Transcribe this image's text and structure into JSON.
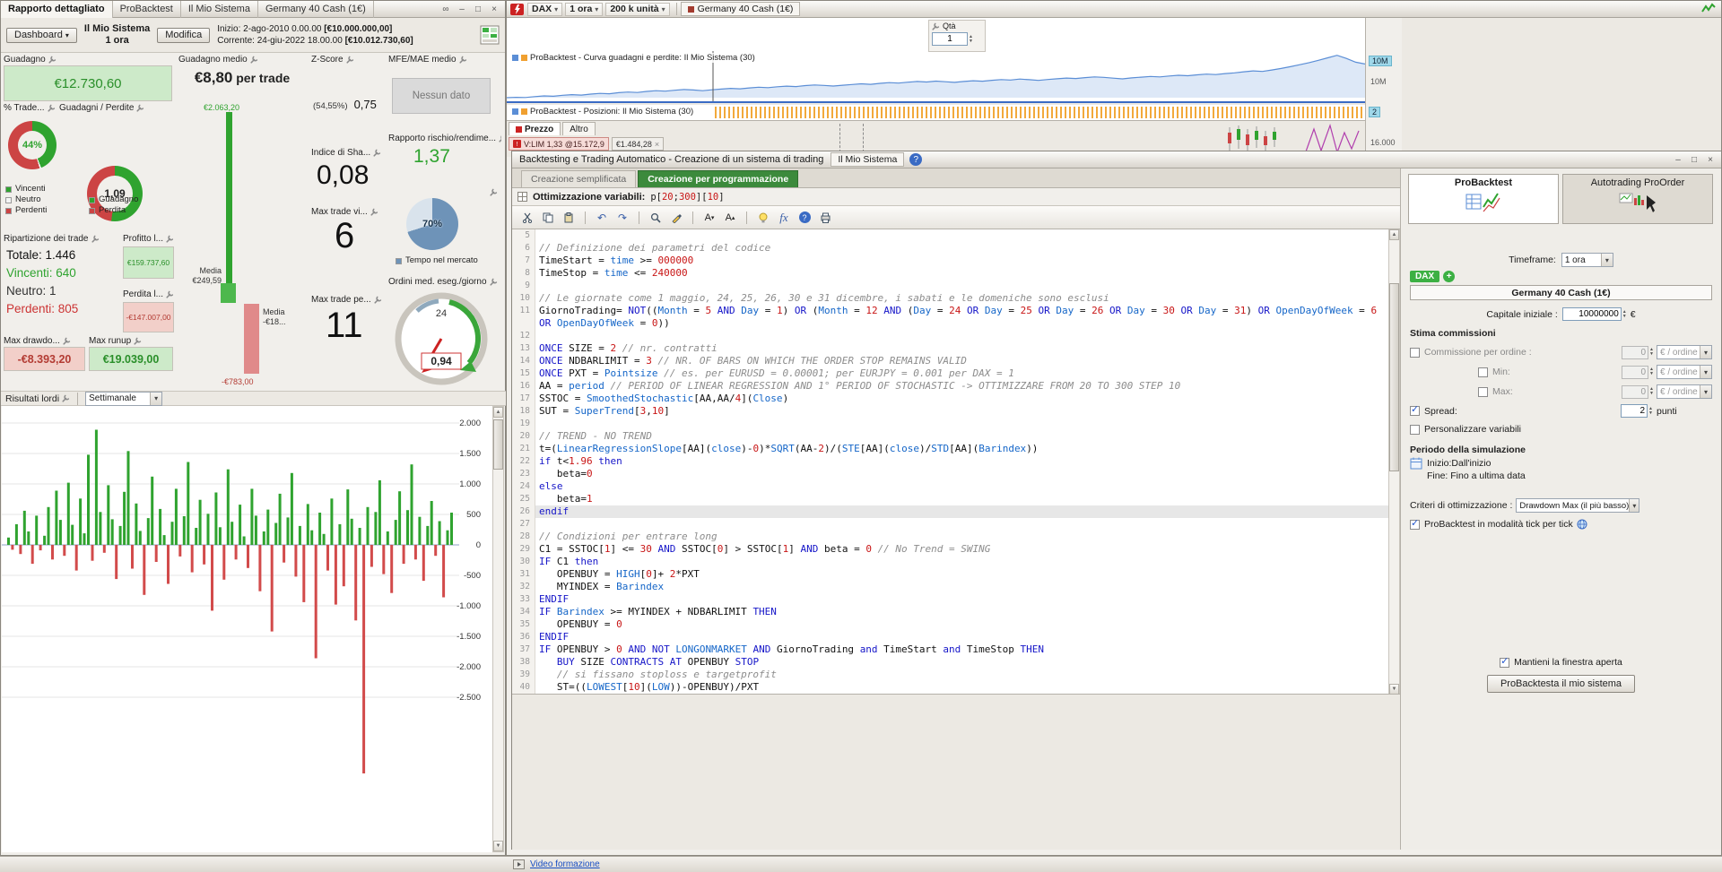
{
  "icons": {
    "link": "∞",
    "minimize": "–",
    "maximize": "□",
    "close": "×",
    "dropdown": "▾",
    "spin_up": "▲",
    "spin_down": "▼",
    "check": "✓",
    "undo": "↶",
    "redo": "↷",
    "font_letter": "A",
    "tri_up": "▴",
    "tri_down": "▾",
    "fx": "fx",
    "help": "?",
    "plus": "+",
    "chip_close": "×"
  },
  "colors": {
    "green": "#2fa32f",
    "green_bg": "#cdeac9",
    "red": "#cc4444",
    "red_bg": "#f2cfc9",
    "blue": "#3a6bc4",
    "orange": "#f0a030",
    "prog_tab_green": "#3c8a3c"
  },
  "left_window": {
    "tabs": [
      "Rapporto dettagliato",
      "ProBacktest",
      "Il Mio Sistema",
      "Germany 40 Cash (1€)"
    ],
    "header": {
      "dashboard_label": "Dashboard",
      "system_name": "Il Mio Sistema",
      "system_timeframe": "1 ora",
      "modify_label": "Modifica",
      "inizio_label": "Inizio:",
      "inizio_datetime": "2-ago-2010 0.00.00",
      "inizio_amount": "[€10.000.000,00]",
      "corrente_label": "Corrente:",
      "corrente_datetime": "24-giu-2022 18.00.00",
      "corrente_amount": "[€10.012.730,60]"
    },
    "stats": {
      "guadagno_label": "Guadagno",
      "guadagno_value": "€12.730,60",
      "gm_label": "Guadagno medio",
      "gm_value": "€8,80",
      "gm_suffix": " per trade",
      "z_label": "Z-Score",
      "z_pct": "(54,55%)",
      "z_value": "0,75",
      "mfe_label": "MFE/MAE medio",
      "mfe_value": "Nessun dato",
      "pct_trade_label": "% Trade...",
      "gp_label": "Guadagni / Perdite",
      "sharpe_label": "Indice di Sha...",
      "sharpe_value": "0,08",
      "rr_label": "Rapporto rischio/rendime...",
      "rr_value": "1,37",
      "mtv_label": "Max trade vi...",
      "mtv_value": "6",
      "mtp_label": "Max trade pe...",
      "mtp_value": "11",
      "ordini_label": "Ordini med. eseg./giorno",
      "rip_label": "Ripartizione dei trade",
      "rip_totale": "Totale: 1.446",
      "rip_vincenti": "Vincenti: 640",
      "rip_neutro": "Neutro: 1",
      "rip_perdenti": "Perdenti: 805",
      "profitto_label": "Profitto l...",
      "profitto_value": "€159.737,60",
      "perdita_label": "Perdita l...",
      "perdita_value": "-€147.007,00",
      "bar_max_label": "€2.063,20",
      "bar_media_pos_1": "Media",
      "bar_media_pos_2": "€249,59",
      "bar_media_neg_1": "Media",
      "bar_media_neg_2": "-€18...",
      "bar_min_label": "-€783,00",
      "mdd_label": "Max drawdo...",
      "mdd_value": "-€8.393,20",
      "mru_label": "Max runup",
      "mru_value": "€19.039,00"
    },
    "bottom_chart": {
      "title": "Risultati lordi",
      "period": "Settimanale"
    }
  },
  "chart_window": {
    "symbol": "DAX",
    "timeframe": "1 ora",
    "units": "200 k unità",
    "instrument_tab": "Germany 40 Cash (1€)",
    "qta_label": "Qtà",
    "qta_value": "1",
    "equity_title": "ProBacktest - Curva guadagni e perdite: Il Mio Sistema (30)",
    "positions_title": "ProBacktest - Posizioni: Il Mio Sistema (30)",
    "axis_equity_badge": "10M",
    "axis_equity_label": "10M",
    "axis_positions_badge": "2",
    "axis_price_label": "16.000",
    "tab_prezzo": "Prezzo",
    "tab_altro": "Altro",
    "chip_vlim": "V:LIM 1,33 @15.172,9",
    "chip_value": "€1.484,28"
  },
  "backtest_window": {
    "title": "Backtesting e Trading Automatico - Creazione di un sistema di trading",
    "title_tab": "Il Mio Sistema",
    "tab_simple": "Creazione semplificata",
    "tab_prog": "Creazione per programmazione",
    "optim_label": "Ottimizzazione variabili:",
    "optim_value": "p[20;300][10]",
    "current_line": 26,
    "code": [
      {
        "n": 5,
        "t": ""
      },
      {
        "n": 6,
        "t": "// Definizione dei parametri del codice"
      },
      {
        "n": 7,
        "t": "TimeStart = time >= 000000"
      },
      {
        "n": 8,
        "t": "TimeStop = time <= 240000"
      },
      {
        "n": 9,
        "t": ""
      },
      {
        "n": 10,
        "t": "// Le giornate come 1 maggio, 24, 25, 26, 30 e 31 dicembre, i sabati e le domeniche sono esclusi"
      },
      {
        "n": 11,
        "t": "GiornoTrading= NOT((Month = 5 AND Day = 1) OR (Month = 12 AND (Day = 24 OR Day = 25 OR Day = 26 OR Day = 30 OR Day = 31) OR OpenDayOfWeek = 6 OR OpenDayOfWeek = 0))"
      },
      {
        "n": 12,
        "t": ""
      },
      {
        "n": 13,
        "t": "ONCE SIZE = 2 // nr. contratti"
      },
      {
        "n": 14,
        "t": "ONCE NDBARLIMIT = 3 // NR. OF BARS ON WHICH THE ORDER STOP REMAINS VALID"
      },
      {
        "n": 15,
        "t": "ONCE PXT = Pointsize // es. per EURUSD = 0.00001; per EURJPY = 0.001 per DAX = 1"
      },
      {
        "n": 16,
        "t": "AA = period // PERIOD OF LINEAR REGRESSION AND 1° PERIOD OF STOCHASTIC -> OTTIMIZZARE FROM 20 TO 300 STEP 10"
      },
      {
        "n": 17,
        "t": "SSTOC = SmoothedStochastic[AA,AA/4](Close)"
      },
      {
        "n": 18,
        "t": "SUT = SuperTrend[3,10]"
      },
      {
        "n": 19,
        "t": ""
      },
      {
        "n": 20,
        "t": "// TREND - NO TREND"
      },
      {
        "n": 21,
        "t": "t=(LinearRegressionSlope[AA](close)-0)*SQRT(AA-2)/(STE[AA](close)/STD[AA](Barindex))"
      },
      {
        "n": 22,
        "t": "if t<1.96 then"
      },
      {
        "n": 23,
        "t": "   beta=0"
      },
      {
        "n": 24,
        "t": "else"
      },
      {
        "n": 25,
        "t": "   beta=1"
      },
      {
        "n": 26,
        "t": "endif"
      },
      {
        "n": 27,
        "t": ""
      },
      {
        "n": 28,
        "t": "// Condizioni per entrare long"
      },
      {
        "n": 29,
        "t": "C1 = SSTOC[1] <= 30 AND SSTOC[0] > SSTOC[1] AND beta = 0 // No Trend = SWING"
      },
      {
        "n": 30,
        "t": "IF C1 then"
      },
      {
        "n": 31,
        "t": "   OPENBUY = HIGH[0]+ 2*PXT"
      },
      {
        "n": 32,
        "t": "   MYINDEX = Barindex"
      },
      {
        "n": 33,
        "t": "ENDIF"
      },
      {
        "n": 34,
        "t": "IF Barindex >= MYINDEX + NDBARLIMIT THEN"
      },
      {
        "n": 35,
        "t": "   OPENBUY = 0"
      },
      {
        "n": 36,
        "t": "ENDIF"
      },
      {
        "n": 37,
        "t": "IF OPENBUY > 0 AND NOT LONGONMARKET AND GiornoTrading and TimeStart and TimeStop THEN"
      },
      {
        "n": 38,
        "t": "   BUY SIZE CONTRACTS AT OPENBUY STOP"
      },
      {
        "n": 39,
        "t": "   // si fissano stoploss e targetprofit"
      },
      {
        "n": 40,
        "t": "   ST=((LOWEST[10](LOW))-OPENBUY)/PXT"
      }
    ],
    "panel": {
      "tab_probacktest": "ProBacktest",
      "tab_autotrading": "Autotrading ProOrder",
      "timeframe_label": "Timeframe:",
      "timeframe_value": "1 ora",
      "symbol": "DAX",
      "instrument": "Germany 40 Cash (1€)",
      "capital_label": "Capitale iniziale :",
      "capital_value": "10000000",
      "capital_unit": "€",
      "commissions_title": "Stima commissioni",
      "comm_label": "Commissione per ordine :",
      "comm_value": "0",
      "per_order_unit": "€ / ordine",
      "min_label": "Min:",
      "min_value": "0",
      "max_label": "Max:",
      "max_value": "0",
      "spread_label": "Spread:",
      "spread_value": "2",
      "spread_unit": "punti",
      "personalize_label": "Personalizzare variabili",
      "period_title": "Periodo della simulazione",
      "period_start": "Inizio:Dall'inizio",
      "period_end": "Fine: Fino a ultima data",
      "criteria_label": "Criteri di ottimizzazione :",
      "criteria_value": "Drawdown Max (il più basso)",
      "tick_label": "ProBacktest in modalità tick per tick",
      "keep_label": "Mantieni la finestra aperta",
      "run_label": "ProBacktesta il mio sistema"
    }
  },
  "bottom_bar": {
    "video_link": "Video formazione"
  },
  "chart_data": [
    {
      "type": "line",
      "name": "equity_curve",
      "title": "ProBacktest - Curva guadagni e perdite: Il Mio Sistema (30)",
      "baseline_label": "10M",
      "currency": "EUR",
      "values": [
        0,
        150,
        80,
        420,
        680,
        540,
        920,
        1150,
        980,
        1340,
        1620,
        1480,
        1890,
        2140,
        1960,
        2380,
        2650,
        2490,
        2820,
        3080,
        2910,
        2640,
        2980,
        3240,
        3520,
        3360,
        3710,
        3950,
        3780,
        4120,
        4380,
        4210,
        4560,
        4820,
        4650,
        4390,
        4710,
        4980,
        5240,
        5060,
        5420,
        5680,
        5510,
        5850,
        6120,
        5940,
        6280,
        6050,
        5780,
        6140,
        6420,
        6250,
        6590,
        6860,
        6680,
        7040,
        6810,
        6540,
        6890,
        7160,
        7420,
        7240,
        7590,
        7860,
        7680,
        7390,
        7120,
        7480,
        7760,
        8040,
        7860,
        8220,
        8490,
        8310,
        8660,
        8930,
        8750,
        9120,
        9400,
        9780,
        10150,
        9920,
        10480,
        11050,
        11720,
        12480,
        13260,
        14120,
        15080,
        16020,
        14850,
        13420,
        12730
      ]
    },
    {
      "type": "bar",
      "name": "weekly_gross_results",
      "title": "Risultati lordi",
      "period": "Settimanale",
      "y_ticks": [
        2000,
        1500,
        1000,
        500,
        0,
        -500,
        -1000,
        -1500,
        -2000,
        -2500
      ],
      "y_tick_labels": [
        "2.000",
        "1.500",
        "1.000",
        "500",
        "0",
        "-500",
        "-1.000",
        "-1.500",
        "-2.000",
        "-2.500"
      ],
      "values": [
        120,
        -80,
        340,
        -150,
        560,
        220,
        -310,
        480,
        -90,
        150,
        620,
        -240,
        890,
        410,
        -180,
        1020,
        330,
        -420,
        760,
        190,
        1480,
        -260,
        1890,
        540,
        -130,
        980,
        420,
        -560,
        310,
        870,
        1540,
        -390,
        680,
        230,
        -820,
        440,
        1120,
        -280,
        590,
        160,
        -640,
        380,
        920,
        -190,
        470,
        1360,
        -450,
        280,
        740,
        -320,
        510,
        -1080,
        860,
        290,
        -570,
        1240,
        380,
        -240,
        660,
        140,
        -380,
        920,
        480,
        -760,
        220,
        580,
        -1420,
        360,
        840,
        -290,
        450,
        1180,
        -520,
        310,
        -940,
        670,
        240,
        -1860,
        530,
        180,
        -420,
        760,
        -980,
        340,
        -680,
        910,
        430,
        -1240,
        280,
        -3750,
        620,
        -360,
        540,
        1060,
        -480,
        220,
        -790,
        410,
        880,
        -310,
        570,
        1320,
        -240,
        460,
        -590,
        310,
        720,
        -180,
        390,
        -860,
        240,
        530
      ]
    },
    {
      "type": "pie",
      "name": "trade-outcome-donut",
      "value_label": "44%",
      "segments": [
        {
          "label": "Vincenti",
          "pct": 44,
          "color": "#2fa32f"
        },
        {
          "label": "Neutro",
          "pct": 1,
          "color": "#f5f5f5"
        },
        {
          "label": "Perdenti",
          "pct": 55,
          "color": "#cc4444"
        }
      ]
    },
    {
      "type": "pie",
      "name": "gain-loss-donut",
      "value_label": "1,09",
      "segments": [
        {
          "label": "Guadagno",
          "pct": 52,
          "color": "#2fa32f"
        },
        {
          "label": "Perdita",
          "pct": 48,
          "color": "#cc4444"
        }
      ]
    },
    {
      "type": "gauge",
      "name": "time-in-market-gauge",
      "label": "70%",
      "value": 70,
      "color": "#6e93b8",
      "rest_color": "#d9e3ec",
      "legend": "Tempo nel mercato"
    },
    {
      "type": "gauge",
      "name": "orders-per-day-gauge",
      "label": "0,94",
      "max_label": "24"
    }
  ]
}
